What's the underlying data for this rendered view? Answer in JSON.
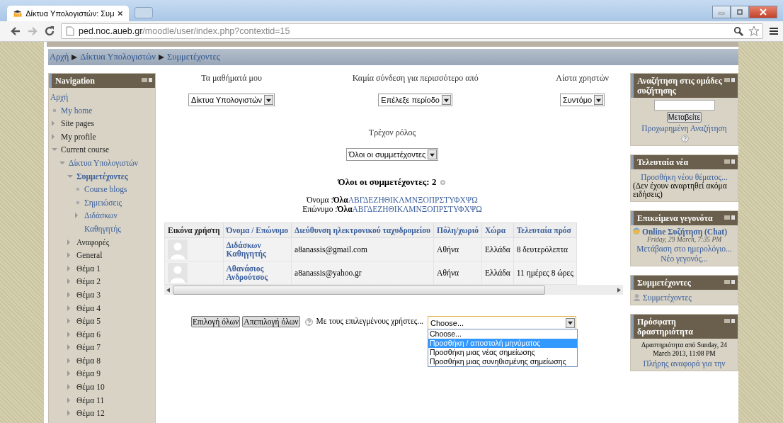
{
  "browser": {
    "tab_title": "Δίκτυα Υπολογιστών: Συμ",
    "url_host": "ped.noc.aueb.gr",
    "url_path": "/moodle/user/index.php?contextid=15"
  },
  "breadcrumb": [
    "Αρχή",
    "Δίκτυα Υπολογιστών",
    "Συμμετέχοντες"
  ],
  "navigation": {
    "title": "Navigation",
    "items": [
      {
        "label": "Αρχή",
        "kind": "root",
        "link": true,
        "selected": false,
        "children": [
          {
            "label": "My home",
            "kind": "leaf",
            "link": true,
            "selected": false
          },
          {
            "label": "Site pages",
            "kind": "branch",
            "expanded": false,
            "link": false,
            "selected": false
          },
          {
            "label": "My profile",
            "kind": "branch",
            "expanded": false,
            "link": false,
            "selected": false
          },
          {
            "label": "Current course",
            "kind": "branch",
            "expanded": true,
            "link": false,
            "selected": false,
            "children": [
              {
                "label": "Δίκτυα Υπολογιστών",
                "kind": "branch",
                "expanded": true,
                "link": true,
                "selected": false,
                "children": [
                  {
                    "label": "Συμμετέχοντες",
                    "kind": "branch",
                    "expanded": true,
                    "link": true,
                    "selected": true,
                    "children": [
                      {
                        "label": "Course blogs",
                        "kind": "leaf",
                        "link": true,
                        "selected": false
                      },
                      {
                        "label": "Σημειώσεις",
                        "kind": "leaf",
                        "link": true,
                        "selected": false
                      },
                      {
                        "label": "Διδάσκων Καθηγητής",
                        "kind": "branch",
                        "expanded": false,
                        "link": true,
                        "selected": false
                      }
                    ]
                  },
                  {
                    "label": "Αναφορές",
                    "kind": "branch",
                    "expanded": false,
                    "link": false,
                    "selected": false
                  },
                  {
                    "label": "General",
                    "kind": "branch",
                    "expanded": false,
                    "link": false,
                    "selected": false
                  },
                  {
                    "label": "Θέμα 1",
                    "kind": "branch",
                    "expanded": false,
                    "link": false,
                    "selected": false
                  },
                  {
                    "label": "Θέμα 2",
                    "kind": "branch",
                    "expanded": false,
                    "link": false,
                    "selected": false
                  },
                  {
                    "label": "Θέμα 3",
                    "kind": "branch",
                    "expanded": false,
                    "link": false,
                    "selected": false
                  },
                  {
                    "label": "Θέμα 4",
                    "kind": "branch",
                    "expanded": false,
                    "link": false,
                    "selected": false
                  },
                  {
                    "label": "Θέμα 5",
                    "kind": "branch",
                    "expanded": false,
                    "link": false,
                    "selected": false
                  },
                  {
                    "label": "Θέμα 6",
                    "kind": "branch",
                    "expanded": false,
                    "link": false,
                    "selected": false
                  },
                  {
                    "label": "Θέμα 7",
                    "kind": "branch",
                    "expanded": false,
                    "link": false,
                    "selected": false
                  },
                  {
                    "label": "Θέμα 8",
                    "kind": "branch",
                    "expanded": false,
                    "link": false,
                    "selected": false
                  },
                  {
                    "label": "Θέμα 9",
                    "kind": "branch",
                    "expanded": false,
                    "link": false,
                    "selected": false
                  },
                  {
                    "label": "Θέμα 10",
                    "kind": "branch",
                    "expanded": false,
                    "link": false,
                    "selected": false
                  },
                  {
                    "label": "Θέμα 11",
                    "kind": "branch",
                    "expanded": false,
                    "link": false,
                    "selected": false
                  },
                  {
                    "label": "Θέμα 12",
                    "kind": "branch",
                    "expanded": false,
                    "link": false,
                    "selected": false
                  }
                ]
              }
            ]
          }
        ]
      }
    ]
  },
  "filters": [
    {
      "label": "Τα μαθήματά μου",
      "value": "Δίκτυα Υπολογιστών"
    },
    {
      "label": "Καμία σύνδεση για περισσότερο από",
      "value": "Επέλεξε περίοδο"
    },
    {
      "label": "Λίστα χρηστών",
      "value": "Συντόμο"
    }
  ],
  "role_filter": {
    "label": "Τρέχον ρόλος",
    "value": "Όλοι οι συμμετέχοντες"
  },
  "participants_heading": "Όλοι οι συμμετέχοντες: 2",
  "initials": [
    {
      "label": "Όνομα :",
      "all": "Όλα",
      "letters": "ΑΒΓΔΕΖΗΘΙΚΛΜΝΞΟΠΡΣΤΥΦΧΨΩ"
    },
    {
      "label": "Επώνυμο :",
      "all": "Όλα",
      "letters": "ΑΒΓΔΕΖΗΘΙΚΛΜΝΞΟΠΡΣΤΥΦΧΨΩ"
    }
  ],
  "table": {
    "columns": [
      {
        "label": "Εικόνα χρήστη",
        "sortable": false
      },
      {
        "label": "Όνομα / Επώνυμο",
        "sortable": true
      },
      {
        "label": "Διεύθυνση ηλεκτρονικού ταχυδρομείου",
        "sortable": true
      },
      {
        "label": "Πόλη/χωριό",
        "sortable": true
      },
      {
        "label": "Χώρα",
        "sortable": true
      },
      {
        "label": "Τελευταία πρόσ",
        "sortable": true
      }
    ],
    "rows": [
      {
        "name": "Διδάσκων Καθηγητής",
        "email": "a8anassis@gmail.com",
        "city": "Αθήνα",
        "country": "Ελλάδα",
        "last_access": "8 δευτερόλεπτα"
      },
      {
        "name": "Αθανάσιος Ανδρούτσος",
        "email": "a8anassis@yahoo.gr",
        "city": "Αθήνα",
        "country": "Ελλάδα",
        "last_access": "11 ημέρες 8 ώρες"
      }
    ]
  },
  "bulk": {
    "buttons": [
      "Επιλογή όλων",
      "Απεπιλογή όλων"
    ],
    "label": "Με τους επιλεγμένους χρήστες...",
    "select_value": "Choose...",
    "options": [
      {
        "label": "Choose...",
        "selected": false
      },
      {
        "label": "Προσθήκη / αποστολή μηνύματος",
        "selected": true
      },
      {
        "label": "Προσθήκη μιας νέας σημείωσης",
        "selected": false
      },
      {
        "label": "Προσθήκη μιας συνηθισμένης σημείωσης",
        "selected": false
      }
    ]
  },
  "blocks": [
    {
      "title": "Αναζήτηση στις ομάδες συζήτησης",
      "items": [
        {
          "kind": "input"
        },
        {
          "kind": "button",
          "text": "Μεταβείτε"
        },
        {
          "kind": "link",
          "text": "Προχωρημένη Αναζήτηση"
        },
        {
          "kind": "help"
        }
      ]
    },
    {
      "title": "Τελευταία νέα",
      "items": [
        {
          "kind": "link",
          "text": "Προσθήκη νέου θέματος..."
        },
        {
          "kind": "text",
          "text": "(Δεν έχουν αναρτηθεί ακόμα ειδήσεις)"
        }
      ]
    },
    {
      "title": "Επικείμενα γεγονότα",
      "items": [
        {
          "kind": "event",
          "text": "Online Συζήτηση (Chat)",
          "date": "Friday, 29 March, 7:35 PM"
        },
        {
          "kind": "link",
          "text": "Μετάβαση στο ημερολόγιο..."
        },
        {
          "kind": "link",
          "text": "Νέο γεγονός..."
        }
      ]
    },
    {
      "title": "Συμμετέχοντες",
      "items": [
        {
          "kind": "user-link",
          "text": "Συμμετέχοντες"
        }
      ]
    },
    {
      "title": "Πρόσφατη δραστηριότητα",
      "items": [
        {
          "kind": "note",
          "text": "Δραστηριότητα από Sunday, 24 March 2013, 11:08 PM"
        },
        {
          "kind": "link",
          "text": "Πλήρης αναφορά για την"
        }
      ]
    }
  ]
}
